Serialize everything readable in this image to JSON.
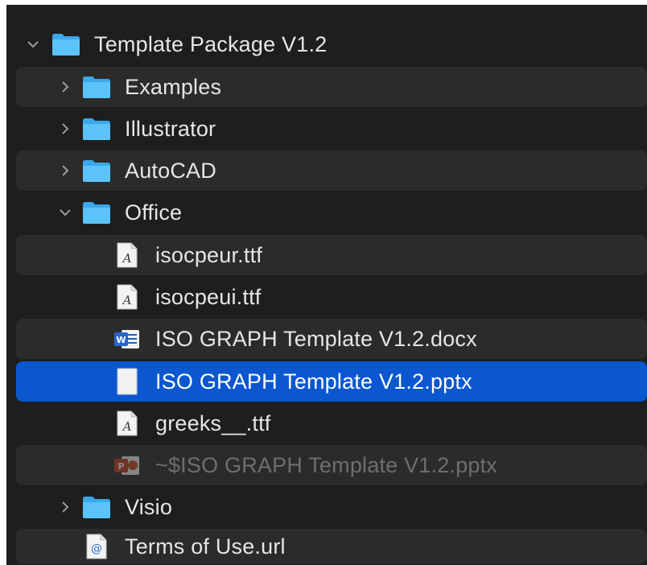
{
  "tree": {
    "root": {
      "label": "Template Package V1.2",
      "icon": "folder-icon",
      "expanded": true
    },
    "items": [
      {
        "label": "Examples",
        "icon": "folder-icon",
        "kind": "folder",
        "expanded": false
      },
      {
        "label": "Illustrator",
        "icon": "folder-icon",
        "kind": "folder",
        "expanded": false
      },
      {
        "label": "AutoCAD",
        "icon": "folder-icon",
        "kind": "folder",
        "expanded": false
      },
      {
        "label": "Office",
        "icon": "folder-icon",
        "kind": "folder",
        "expanded": true
      },
      {
        "label": "isocpeur.ttf",
        "icon": "font-file-icon",
        "kind": "file"
      },
      {
        "label": "isocpeui.ttf",
        "icon": "font-file-icon",
        "kind": "file"
      },
      {
        "label": "ISO GRAPH Template V1.2.docx",
        "icon": "word-document-icon",
        "kind": "file"
      },
      {
        "label": "ISO GRAPH Template V1.2.pptx",
        "icon": "blank-document-icon",
        "kind": "file",
        "selected": true
      },
      {
        "label": "greeks__.ttf",
        "icon": "font-file-icon",
        "kind": "file"
      },
      {
        "label": "~$ISO GRAPH Template V1.2.pptx",
        "icon": "powerpoint-document-icon",
        "kind": "file",
        "dimmed": true
      },
      {
        "label": "Visio",
        "icon": "folder-icon",
        "kind": "folder",
        "expanded": false
      },
      {
        "label": "Terms of Use.url",
        "icon": "url-file-icon",
        "kind": "file"
      }
    ]
  },
  "colors": {
    "background": "#1e1e1e",
    "alternate_row": "#2b2b2b",
    "selection": "#0a57d0",
    "folder": "#4cb8f4",
    "text": "#e6e6e6",
    "dimmed_text": "#6e6e6e"
  }
}
